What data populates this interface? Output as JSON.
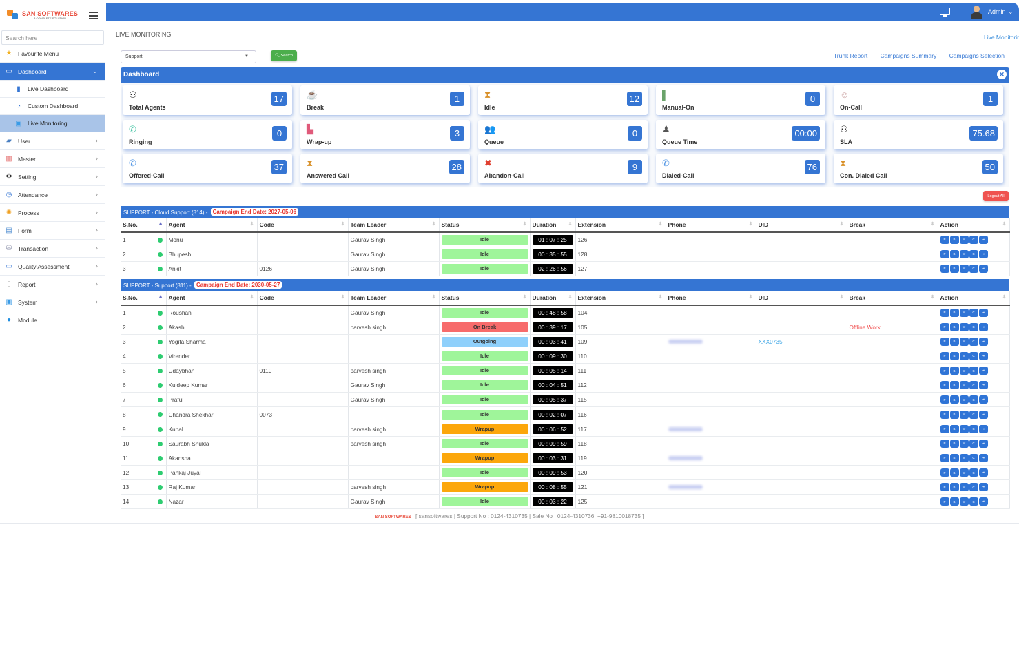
{
  "brand": {
    "name": "SAN SOFTWARES",
    "tagline": "A COMPLETE SOLUTION",
    "accent": "#3575d3"
  },
  "sidebar": {
    "search_placeholder": "Search here",
    "items": [
      {
        "label": "Favourite Menu",
        "icon": "star-icon"
      },
      {
        "label": "Dashboard",
        "icon": "monitor-icon",
        "active": true
      },
      {
        "label": "Live Dashboard",
        "icon": "bar-chart-icon",
        "sub": true
      },
      {
        "label": "Custom Dashboard",
        "icon": "gauge-icon",
        "sub": true
      },
      {
        "label": "Live Monitoring",
        "icon": "screen-icon",
        "sub": true,
        "current": true
      },
      {
        "label": "User",
        "icon": "user-folder-icon"
      },
      {
        "label": "Master",
        "icon": "binders-icon"
      },
      {
        "label": "Setting",
        "icon": "gear-icon"
      },
      {
        "label": "Attendance",
        "icon": "clock-icon"
      },
      {
        "label": "Process",
        "icon": "cog-icon"
      },
      {
        "label": "Form",
        "icon": "form-icon"
      },
      {
        "label": "Transaction",
        "icon": "database-icon"
      },
      {
        "label": "Quality Assessment",
        "icon": "monitor-icon"
      },
      {
        "label": "Report",
        "icon": "report-icon"
      },
      {
        "label": "System",
        "icon": "system-icon"
      },
      {
        "label": "Module",
        "icon": "grid-icon"
      }
    ]
  },
  "topbar": {
    "user": "Admin"
  },
  "page": {
    "title": "LIVE MONITORING",
    "breadcrumb": "Live Monitorir"
  },
  "filter": {
    "campaign": "Support",
    "search_label": "Search"
  },
  "links": [
    "Trunk Report",
    "Campaigns Summary",
    "Campaigns Selection"
  ],
  "dashboard": {
    "title": "Dashboard",
    "cards": [
      {
        "label": "Total Agents",
        "value": "17",
        "icon": "agent-icon"
      },
      {
        "label": "Break",
        "value": "1",
        "icon": "coffee-break-icon"
      },
      {
        "label": "Idle",
        "value": "12",
        "icon": "hourglass-icon"
      },
      {
        "label": "Manual-On",
        "value": "0",
        "icon": "book-icon"
      },
      {
        "label": "On-Call",
        "value": "1",
        "icon": "operator-icon"
      },
      {
        "label": "Ringing",
        "value": "0",
        "icon": "ringing-phone-icon"
      },
      {
        "label": "Wrap-up",
        "value": "3",
        "icon": "wrap-icon"
      },
      {
        "label": "Queue",
        "value": "0",
        "icon": "people-queue-icon"
      },
      {
        "label": "Queue Time",
        "value": "00:00",
        "icon": "queue-time-icon"
      },
      {
        "label": "SLA",
        "value": "75.68",
        "icon": "agent-icon"
      },
      {
        "label": "Offered-Call",
        "value": "37",
        "icon": "incoming-call-icon"
      },
      {
        "label": "Answered Call",
        "value": "28",
        "icon": "hourglass-icon"
      },
      {
        "label": "Abandon-Call",
        "value": "9",
        "icon": "missed-call-icon"
      },
      {
        "label": "Dialed-Call",
        "value": "76",
        "icon": "outgoing-call-icon"
      },
      {
        "label": "Con. Dialed Call",
        "value": "50",
        "icon": "hourglass-icon"
      }
    ],
    "logout_all": "Logout All"
  },
  "columns": [
    "S.No.",
    "Agent",
    "Code",
    "Team Leader",
    "Status",
    "Duration",
    "Extension",
    "Phone",
    "DID",
    "Break",
    "Action"
  ],
  "action_buttons": [
    "P",
    "B",
    "W",
    "C",
    "⇥"
  ],
  "tables": [
    {
      "title": "SUPPORT - Cloud Support (814) -",
      "end_date": "Campaign End Date: 2027-05-06",
      "rows": [
        {
          "sno": "1",
          "agent": "Monu",
          "code": "",
          "leader": "Gaurav Singh",
          "status": "Idle",
          "duration": "01 : 07 : 25",
          "ext": "126",
          "phone": "",
          "did": "",
          "brk": ""
        },
        {
          "sno": "2",
          "agent": "Bhupesh",
          "code": "",
          "leader": "Gaurav Singh",
          "status": "Idle",
          "duration": "00 : 35 : 55",
          "ext": "128",
          "phone": "",
          "did": "",
          "brk": ""
        },
        {
          "sno": "3",
          "agent": "Ankit",
          "code": "0126",
          "leader": "Gaurav Singh",
          "status": "Idle",
          "duration": "02 : 26 : 56",
          "ext": "127",
          "phone": "",
          "did": "",
          "brk": ""
        }
      ]
    },
    {
      "title": "SUPPORT - Support (811) -",
      "end_date": "Campaign End Date: 2030-05-27",
      "rows": [
        {
          "sno": "1",
          "agent": "Roushan",
          "code": "",
          "leader": "Gaurav Singh",
          "status": "Idle",
          "duration": "00 : 48 : 58",
          "ext": "104",
          "phone": "",
          "did": "",
          "brk": ""
        },
        {
          "sno": "2",
          "agent": "Akash",
          "code": "",
          "leader": "parvesh singh",
          "status": "On Break",
          "duration": "00 : 39 : 17",
          "ext": "105",
          "phone": "",
          "did": "",
          "brk": "Offline Work"
        },
        {
          "sno": "3",
          "agent": "Yogita Sharma",
          "code": "",
          "leader": "",
          "status": "Outgoing",
          "duration": "00 : 03 : 41",
          "ext": "109",
          "phone": "blurred",
          "did": "XXX0735",
          "brk": ""
        },
        {
          "sno": "4",
          "agent": "Virender",
          "code": "",
          "leader": "",
          "status": "Idle",
          "duration": "00 : 09 : 30",
          "ext": "110",
          "phone": "",
          "did": "",
          "brk": ""
        },
        {
          "sno": "5",
          "agent": "Udaybhan",
          "code": "0110",
          "leader": "parvesh singh",
          "status": "Idle",
          "duration": "00 : 05 : 14",
          "ext": "111",
          "phone": "",
          "did": "",
          "brk": ""
        },
        {
          "sno": "6",
          "agent": "Kuldeep Kumar",
          "code": "",
          "leader": "Gaurav Singh",
          "status": "Idle",
          "duration": "00 : 04 : 51",
          "ext": "112",
          "phone": "",
          "did": "",
          "brk": ""
        },
        {
          "sno": "7",
          "agent": "Praful",
          "code": "",
          "leader": "Gaurav Singh",
          "status": "Idle",
          "duration": "00 : 05 : 37",
          "ext": "115",
          "phone": "",
          "did": "",
          "brk": ""
        },
        {
          "sno": "8",
          "agent": "Chandra Shekhar",
          "code": "0073",
          "leader": "",
          "status": "Idle",
          "duration": "00 : 02 : 07",
          "ext": "116",
          "phone": "",
          "did": "",
          "brk": ""
        },
        {
          "sno": "9",
          "agent": "Kunal",
          "code": "",
          "leader": "parvesh singh",
          "status": "Wrapup",
          "duration": "00 : 06 : 52",
          "ext": "117",
          "phone": "blurred",
          "did": "",
          "brk": ""
        },
        {
          "sno": "10",
          "agent": "Saurabh Shukla",
          "code": "",
          "leader": "parvesh singh",
          "status": "Idle",
          "duration": "00 : 09 : 59",
          "ext": "118",
          "phone": "",
          "did": "",
          "brk": ""
        },
        {
          "sno": "11",
          "agent": "Akansha",
          "code": "",
          "leader": "",
          "status": "Wrapup",
          "duration": "00 : 03 : 31",
          "ext": "119",
          "phone": "blurred",
          "did": "",
          "brk": ""
        },
        {
          "sno": "12",
          "agent": "Pankaj Juyal",
          "code": "",
          "leader": "",
          "status": "Idle",
          "duration": "00 : 09 : 53",
          "ext": "120",
          "phone": "",
          "did": "",
          "brk": ""
        },
        {
          "sno": "13",
          "agent": "Raj Kumar",
          "code": "",
          "leader": "parvesh singh",
          "status": "Wrapup",
          "duration": "00 : 08 : 55",
          "ext": "121",
          "phone": "blurred",
          "did": "",
          "brk": ""
        },
        {
          "sno": "14",
          "agent": "Nazar",
          "code": "",
          "leader": "Gaurav Singh",
          "status": "Idle",
          "duration": "00 : 03 : 22",
          "ext": "125",
          "phone": "",
          "did": "",
          "brk": ""
        }
      ]
    }
  ],
  "status_colors": {
    "Idle": "#9ff59a",
    "On Break": "#f76b6b",
    "Outgoing": "#8fd0fb",
    "Wrapup": "#fca70b"
  },
  "footer": {
    "text": "[ sansoftwares | Support No : 0124-4310735 | Sale No : 0124-4310736, +91-9810018735 ]"
  }
}
